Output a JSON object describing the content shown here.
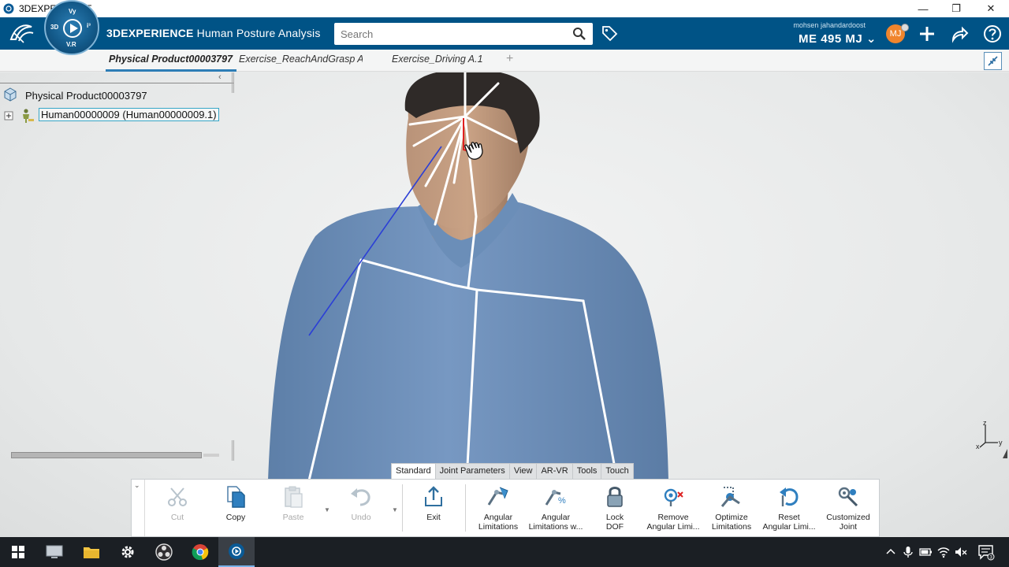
{
  "window": {
    "title": "3DEXPERIENCE",
    "controls": [
      "—",
      "❐",
      "✕"
    ]
  },
  "header": {
    "brand_bold": "3D",
    "brand_rest": "EXPERIENCE",
    "app_name": "Human Posture Analysis",
    "compass": {
      "top": "Vy",
      "left": "3D",
      "right": "i³",
      "bottom": "V.R"
    },
    "search_placeholder": "Search",
    "user_name": "mohsen jahandardoost",
    "user_id": "ME 495 MJ",
    "avatar_initials": "MJ"
  },
  "tabs": [
    {
      "label": "Physical Product00003797",
      "active": true
    },
    {
      "label": "Exercise_ReachAndGrasp A.",
      "active": false
    },
    {
      "label": "Exercise_Driving A.1",
      "active": false
    }
  ],
  "tree": {
    "collapse_arrow": "‹",
    "root": "Physical Product00003797",
    "child": "Human00000009 (Human00000009.1)"
  },
  "triad": {
    "z": "z",
    "x": "x",
    "y": "y"
  },
  "action_bar": {
    "tabs": [
      {
        "label": "Standard",
        "active": true
      },
      {
        "label": "Joint Parameters",
        "active": false
      },
      {
        "label": "View",
        "active": false
      },
      {
        "label": "AR-VR",
        "active": false
      },
      {
        "label": "Tools",
        "active": false
      },
      {
        "label": "Touch",
        "active": false
      }
    ],
    "buttons": {
      "cut": "Cut",
      "copy": "Copy",
      "paste": "Paste",
      "undo": "Undo",
      "exit": "Exit",
      "angular_limitations_1": "Angular",
      "angular_limitations_2": "Limitations",
      "angular_limitations_w_1": "Angular",
      "angular_limitations_w_2": "Limitations w...",
      "lock_dof_1": "Lock",
      "lock_dof_2": "DOF",
      "remove_angular_1": "Remove",
      "remove_angular_2": "Angular Limi...",
      "optimize_1": "Optimize",
      "optimize_2": "Limitations",
      "reset_angular_1": "Reset",
      "reset_angular_2": "Angular Limi...",
      "customized_1": "Customized",
      "customized_2": "Joint"
    }
  },
  "colors": {
    "header_bg": "#005386",
    "accent": "#2d7db6",
    "shirt": "#6f93bd",
    "skeleton": "#ffffff",
    "reach_line": "#2b3fd6",
    "taskbar": "#1b1f24"
  }
}
